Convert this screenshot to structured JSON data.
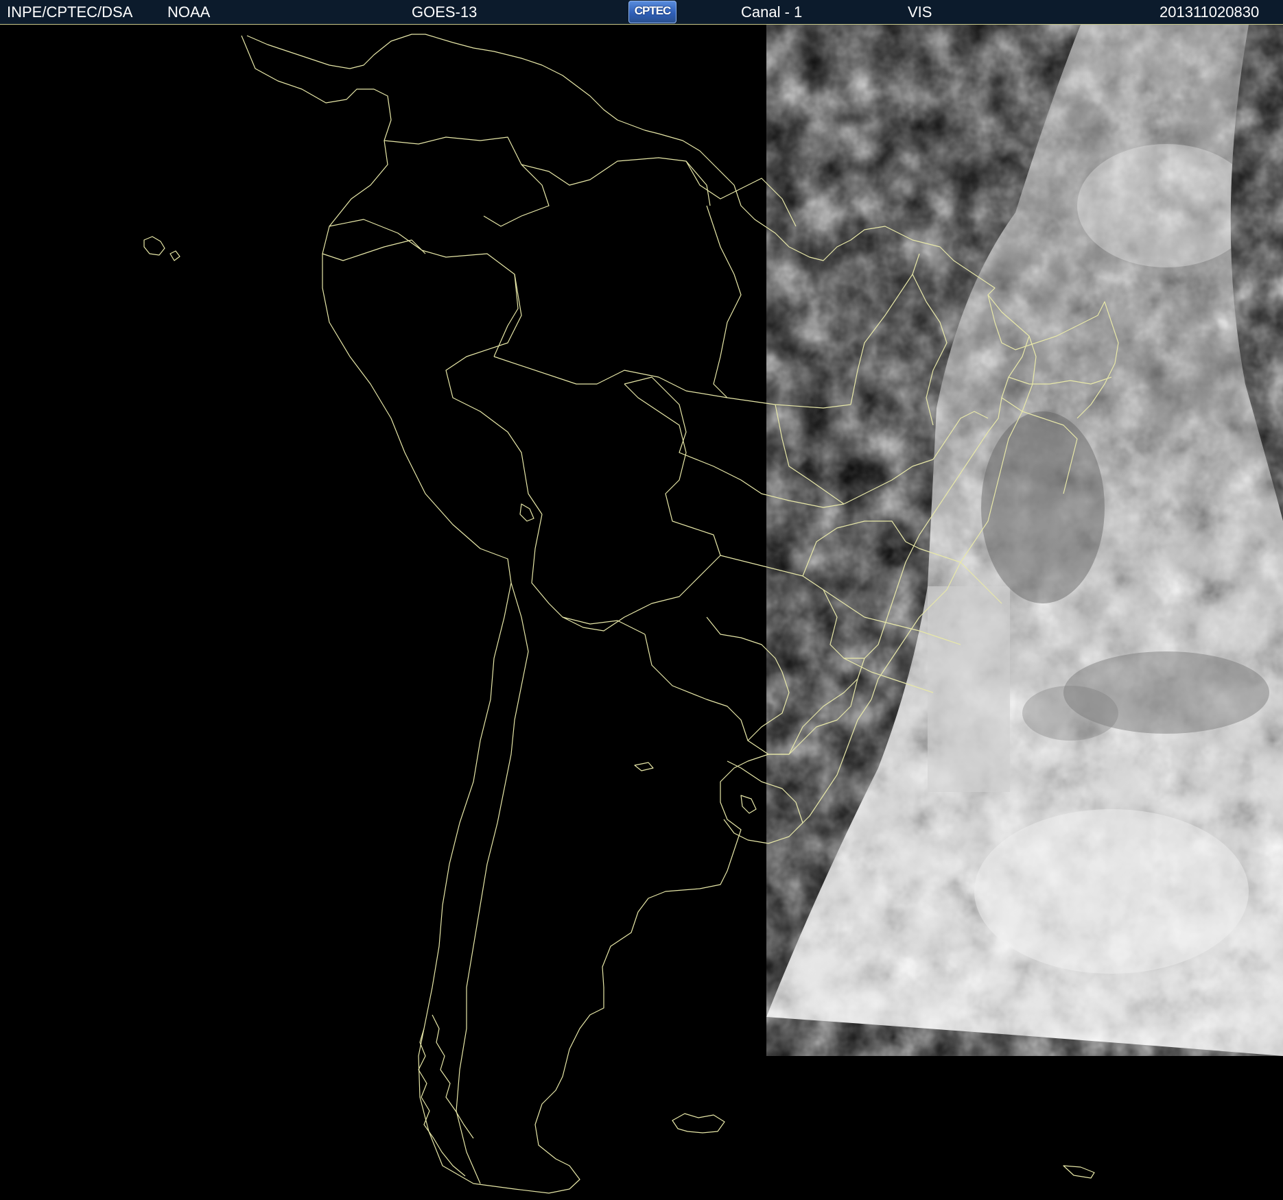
{
  "header": {
    "organization": "INPE/CPTEC/DSA",
    "agency": "NOAA",
    "satellite": "GOES-13",
    "logo_text": "CPTEC",
    "logo_icon": "cptec-logo",
    "channel": "Canal - 1",
    "band": "VIS",
    "timestamp": "201311020830"
  },
  "colors": {
    "background": "#000000",
    "header_background": "#0c1b2c",
    "border_lines": "#e8e8a8",
    "cloud_light": "#e6e6e6",
    "cloud_dark": "#6e6e6e"
  }
}
